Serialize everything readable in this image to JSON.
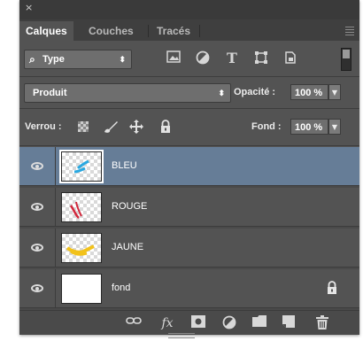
{
  "window": {
    "close_glyph": "×"
  },
  "tabs": [
    {
      "label": "Calques",
      "active": true
    },
    {
      "label": "Couches",
      "active": false
    },
    {
      "label": "Tracés",
      "active": false
    }
  ],
  "filter": {
    "glyph": "⌕",
    "value": "Type",
    "arrows": "⬍"
  },
  "filter_icons": [
    "image-filter-icon",
    "adjustment-filter-icon",
    "type-filter-icon",
    "shape-filter-icon",
    "smart-object-filter-icon"
  ],
  "blend": {
    "value": "Produit",
    "arrows": "⬍"
  },
  "opacity": {
    "label": "Opacité :",
    "value": "100 %"
  },
  "lock": {
    "label": "Verrou :"
  },
  "fill": {
    "label": "Fond :",
    "value": "100 %"
  },
  "layers": [
    {
      "name": "BLEU",
      "selected": true,
      "thumb_color": "#29a8e0"
    },
    {
      "name": "ROUGE",
      "selected": false,
      "thumb_color": "#d1283c"
    },
    {
      "name": "JAUNE",
      "selected": false,
      "thumb_color": "#f2c21b"
    },
    {
      "name": "fond",
      "selected": false,
      "locked": true
    }
  ],
  "bottom_icons": [
    "link-layers-icon",
    "fx-icon",
    "add-mask-icon",
    "new-adjustment-icon",
    "new-group-icon",
    "new-layer-icon",
    "delete-layer-icon"
  ],
  "colors": {
    "panel": "#535353",
    "selected_row": "#667d97",
    "tabbar": "#3f3f3f"
  }
}
